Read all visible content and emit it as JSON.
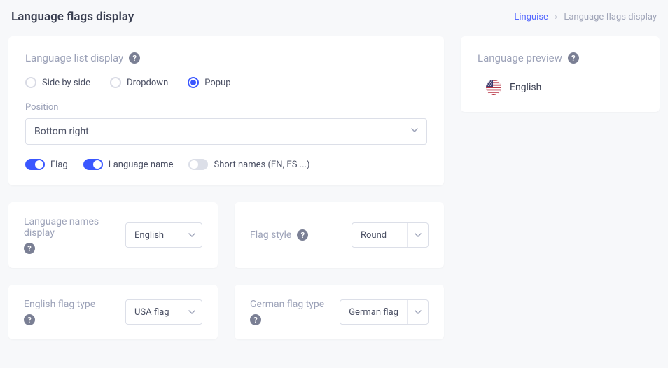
{
  "page": {
    "title": "Language flags display"
  },
  "breadcrumb": {
    "root": "Linguise",
    "current": "Language flags display"
  },
  "listDisplay": {
    "heading": "Language list display",
    "options": {
      "side": "Side by side",
      "dropdown": "Dropdown",
      "popup": "Popup"
    },
    "selected": "popup",
    "positionLabel": "Position",
    "positionValue": "Bottom right",
    "toggles": {
      "flag": {
        "label": "Flag",
        "on": true
      },
      "languageName": {
        "label": "Language name",
        "on": true
      },
      "shortNames": {
        "label": "Short names (EN, ES ...)",
        "on": false
      }
    }
  },
  "preview": {
    "heading": "Language preview",
    "language": "English"
  },
  "namesDisplay": {
    "label": "Language names display",
    "value": "English"
  },
  "flagStyle": {
    "label": "Flag style",
    "value": "Round"
  },
  "englishFlag": {
    "label": "English flag type",
    "value": "USA flag"
  },
  "germanFlag": {
    "label": "German flag type",
    "value": "German flag"
  }
}
